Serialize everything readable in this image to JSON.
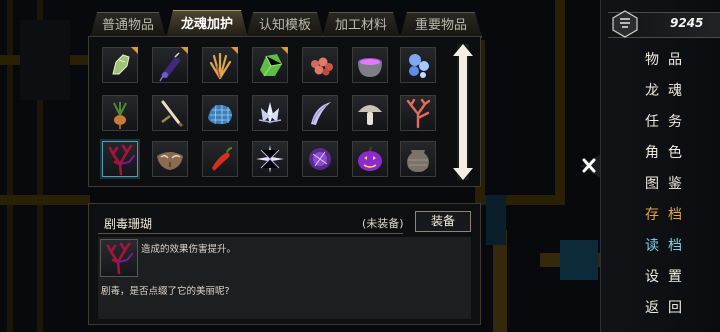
{
  "tabs": [
    {
      "label": "普通物品",
      "active": false
    },
    {
      "label": "龙魂加护",
      "active": true
    },
    {
      "label": "认知模板",
      "active": false
    },
    {
      "label": "加工材料",
      "active": false
    },
    {
      "label": "重要物品",
      "active": false
    }
  ],
  "items": [
    {
      "icon": "green-jade-fragment-icon",
      "corner": true
    },
    {
      "icon": "purple-talisman-icon",
      "corner": true
    },
    {
      "icon": "golden-feather-bundle-icon",
      "corner": true
    },
    {
      "icon": "green-crystal-stone-icon",
      "corner": true
    },
    {
      "icon": "red-coral-cluster-icon",
      "corner": false
    },
    {
      "icon": "purple-cauldron-icon",
      "corner": false
    },
    {
      "icon": "blue-bubbles-icon",
      "corner": false
    },
    {
      "icon": "mandrake-root-icon",
      "corner": false
    },
    {
      "icon": "bone-sword-icon",
      "corner": false
    },
    {
      "icon": "blue-gem-cluster-icon",
      "corner": false
    },
    {
      "icon": "white-crystal-lotus-icon",
      "corner": false
    },
    {
      "icon": "dragon-fang-icon",
      "corner": false
    },
    {
      "icon": "mushroom-icon",
      "corner": false
    },
    {
      "icon": "red-branch-coral-icon",
      "corner": false
    },
    {
      "icon": "venom-coral-icon",
      "corner": false,
      "selected": true
    },
    {
      "icon": "carved-mask-icon",
      "corner": false
    },
    {
      "icon": "red-chili-icon",
      "corner": false
    },
    {
      "icon": "ice-star-icon",
      "corner": false
    },
    {
      "icon": "violet-orb-icon",
      "corner": false
    },
    {
      "icon": "pumpkin-lantern-icon",
      "corner": false
    },
    {
      "icon": "clay-pot-icon",
      "corner": false
    }
  ],
  "detail": {
    "name": "剧毒珊瑚",
    "status": "(未装备)",
    "equip_label": "装备",
    "effect": "造成的效果伤害提升。",
    "flavor": "剧毒，是否点缀了它的美丽呢?"
  },
  "sidebar": {
    "money": "9245",
    "menu": [
      {
        "label": "物品",
        "color": "#f0ebe0"
      },
      {
        "label": "龙魂",
        "color": "#f0ebe0"
      },
      {
        "label": "任务",
        "color": "#f0ebe0"
      },
      {
        "label": "角色",
        "color": "#f0ebe0"
      },
      {
        "label": "图鉴",
        "color": "#f0ebe0"
      },
      {
        "label": "存档",
        "color": "#e2a24a"
      },
      {
        "label": "读档",
        "color": "#7fd3e6"
      },
      {
        "label": "设置",
        "color": "#f0ebe0"
      },
      {
        "label": "返回",
        "color": "#f0ebe0"
      }
    ]
  },
  "colors": {
    "accent_orange": "#e2a24a",
    "accent_cyan": "#7fd3e6",
    "corner_marker": "#e59a22",
    "selection": "#4d9fb3"
  }
}
